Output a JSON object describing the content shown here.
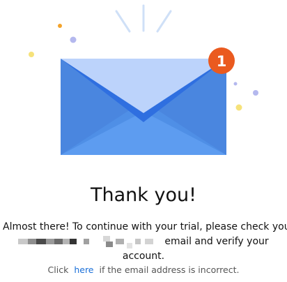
{
  "colors": {
    "envelope_body": "#4f8fe6",
    "envelope_flap_open": "#bcd3fb",
    "envelope_inner_flap": "#3b78e0",
    "badge": "#ea5a1f",
    "sparkle_rays": "#cfe0f7",
    "dot_orange": "#f4a32a",
    "dot_yellow": "#f6e27a",
    "dot_lavender": "#b4b8ee",
    "link": "#1a6fd8"
  },
  "illustration": {
    "icon": "envelope-icon",
    "badge_count": "1"
  },
  "title": "Thank you!",
  "message": {
    "line1": "Almost there! To continue with your trial, please check your",
    "email_redacted": "",
    "line2_after_email": "email and verify your",
    "line3": "account."
  },
  "hint": {
    "prefix": "Click",
    "link_text": "here",
    "suffix": "if the email address is incorrect."
  }
}
